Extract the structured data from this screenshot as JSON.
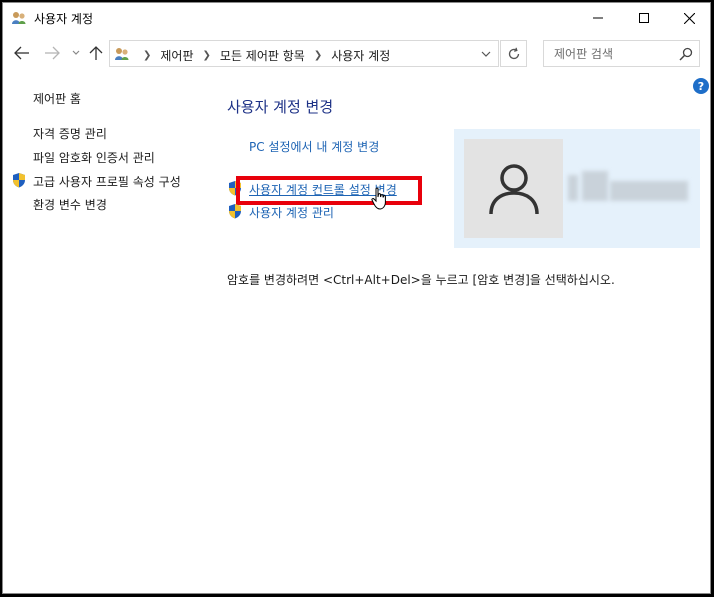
{
  "window": {
    "title": "사용자 계정"
  },
  "address": {
    "crumbs": [
      "제어판",
      "모든 제어판 항목",
      "사용자 계정"
    ],
    "search_placeholder": "제어판 검색"
  },
  "help": {
    "label": "?"
  },
  "sidebar": {
    "home": "제어판 홈",
    "items": [
      {
        "label": "자격 증명 관리",
        "shield": false
      },
      {
        "label": "파일 암호화 인증서 관리",
        "shield": false
      },
      {
        "label": "고급 사용자 프로필 속성 구성",
        "shield": true
      },
      {
        "label": "환경 변수 변경",
        "shield": false
      }
    ]
  },
  "main": {
    "title": "사용자 계정 변경",
    "links": [
      {
        "label": "PC 설정에서 내 계정 변경",
        "shield": false
      },
      {
        "label": "사용자 계정 컨트롤 설정 변경",
        "shield": true,
        "highlighted": true
      },
      {
        "label": "사용자 계정 관리",
        "shield": true
      }
    ],
    "note": "암호를 변경하려면 <Ctrl+Alt+Del>을 누르고 [암호 변경]을 선택하십시오."
  },
  "colors": {
    "link": "#1e64b4",
    "heading": "#1e3287",
    "highlight": "#e8000b",
    "profile_bg": "#e5f1fb",
    "avatar_bg": "#e3e3e3"
  }
}
